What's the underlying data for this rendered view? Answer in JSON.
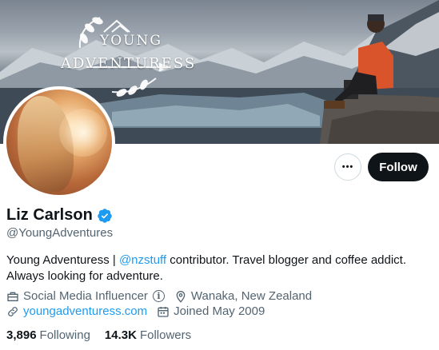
{
  "banner": {
    "logo_line1": "YOUNG",
    "logo_line2": "ADVENTURESS"
  },
  "actions": {
    "more_label": "•••",
    "follow_label": "Follow"
  },
  "profile": {
    "name": "Liz Carlson",
    "handle": "@YoungAdventures",
    "bio_before": "Young Adventuress | ",
    "bio_mention": "@nzstuff",
    "bio_after": " contributor. Travel blogger and coffee addict. Always looking for adventure.",
    "category": "Social Media Influencer",
    "location": "Wanaka, New Zealand",
    "website": "youngadventuress.com",
    "joined": "Joined May 2009"
  },
  "stats": {
    "following_count": "3,896",
    "following_label": "Following",
    "followers_count": "14.3K",
    "followers_label": "Followers"
  },
  "colors": {
    "accent": "#1d9bf0",
    "text": "#0f1419",
    "muted": "#536471",
    "follow_bg": "#0f1419"
  }
}
